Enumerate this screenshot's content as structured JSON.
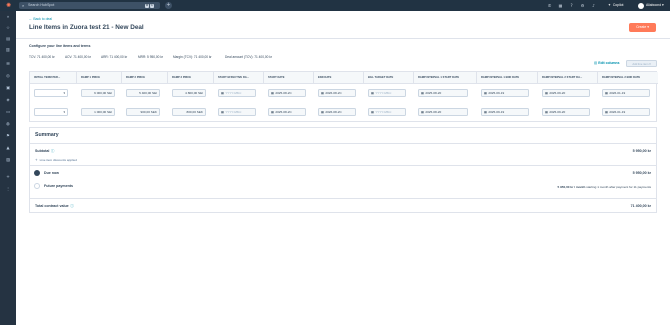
{
  "topbar": {
    "search_placeholder": "Search HubSpot",
    "kbd_mod": "⌘",
    "kbd_key": "K",
    "copilot_label": "Copilot",
    "account_label": "Aliaboond",
    "account_caret": "▾",
    "icons": [
      "phone-icon",
      "marketplace-icon",
      "help-icon",
      "settings-icon",
      "bell-icon"
    ]
  },
  "header": {
    "back_link": "← Back to deal",
    "title": "Line Items in Zuora test 21 - New Deal",
    "create_button": "Create ▾"
  },
  "config": {
    "section_label": "Configure your line items and terms",
    "metrics": [
      "TCV: 71 400,00 kr",
      "ACV: 71 400,00 kr",
      "ARR: 71 400,00 kr",
      "MRR: 5 950,00 kr",
      "Margin (TCV): 71 400,00 kr",
      "Deal amount (TCV): 71 400,00 kr"
    ],
    "edit_columns": "Edit columns",
    "add_line_item": "Add line item ▾"
  },
  "table": {
    "headers": [
      "INITIAL TERM PER...",
      "RAMP 1 PRICE",
      "RAMP 2 PRICE",
      "RAMP 3 PRICE",
      "START EFFECTIVE DA...",
      "START DATE",
      "END DATE",
      "BILL TARGET DATE",
      "RAMP INTERVAL 1 START DATE",
      "RAMP INTERVAL 1 END DATE",
      "RAMP INTERVAL 2 START DA...",
      "RAMP INTERVAL 2 END DATE"
    ],
    "rows": [
      {
        "initial_term": "",
        "ramp1": "6 000,00 SEI",
        "ramp2": "5 400,00 SEI",
        "ramp3": "4 800,00 SEI",
        "start_effective": "YYYY-MM-I",
        "start_date": "2025-08-2C",
        "end_date": "2026-08-2C",
        "bill_target": "YYYY-MM-I",
        "ri1_start": "2025-08-20",
        "ri1_end": "2025-09-19",
        "ri2_start": "2025-09-20",
        "ri2_end": "2026-01-19"
      },
      {
        "initial_term": "",
        "ramp1": "1 000,00 SEI",
        "ramp2": "900,00 SEK",
        "ramp3": "800,00 SEK",
        "start_effective": "YYYY-MM-I",
        "start_date": "2025-08-2C",
        "end_date": "2026-08-2C",
        "bill_target": "YYYY-MM-I",
        "ri1_start": "2025-08-20",
        "ri1_end": "2025-09-19",
        "ri2_start": "2025-09-20",
        "ri2_end": "2026-01-19"
      }
    ]
  },
  "summary": {
    "title": "Summary",
    "subtotal_label": "Subtotal",
    "subtotal_value": "5 950,00 kr",
    "discount_text": "Line item discounts applied",
    "due_now_label": "Due now",
    "due_now_value": "5 950,00 kr",
    "future_label": "Future payments",
    "future_amount": "5 950,00 kr / month",
    "future_note": "starting 1 month after payment for 11 payments",
    "tcv_label": "Total contract value",
    "tcv_value": "71 400,00 kr"
  },
  "colors": {
    "topbar": "#213343",
    "sidebar": "#253342",
    "accent": "#ff7a59",
    "link": "#0091ae"
  }
}
